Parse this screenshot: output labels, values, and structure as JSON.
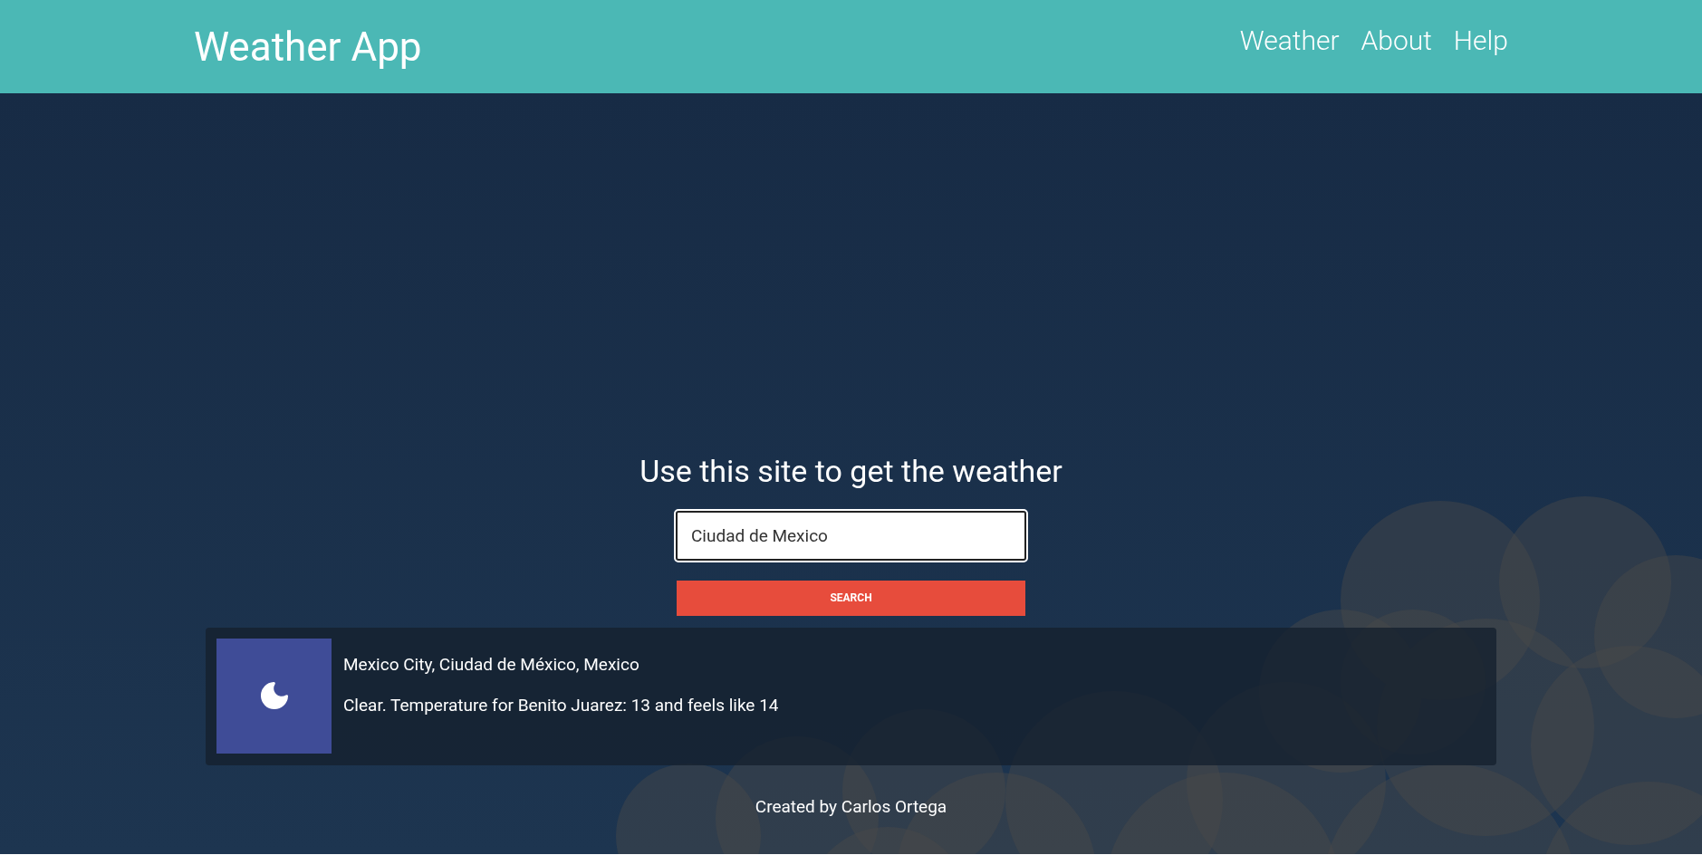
{
  "header": {
    "title": "Weather App",
    "nav": [
      {
        "label": "Weather"
      },
      {
        "label": "About"
      },
      {
        "label": "Help"
      }
    ]
  },
  "main": {
    "heading": "Use this site to get the weather",
    "search": {
      "value": "Ciudad de Mexico"
    },
    "button": "SEARCH",
    "result": {
      "location": "Mexico City, Ciudad de México, Mexico",
      "forecast": "Clear. Temperature for Benito Juarez: 13 and feels like 14"
    }
  },
  "footer": {
    "text": "Created by Carlos Ortega"
  }
}
